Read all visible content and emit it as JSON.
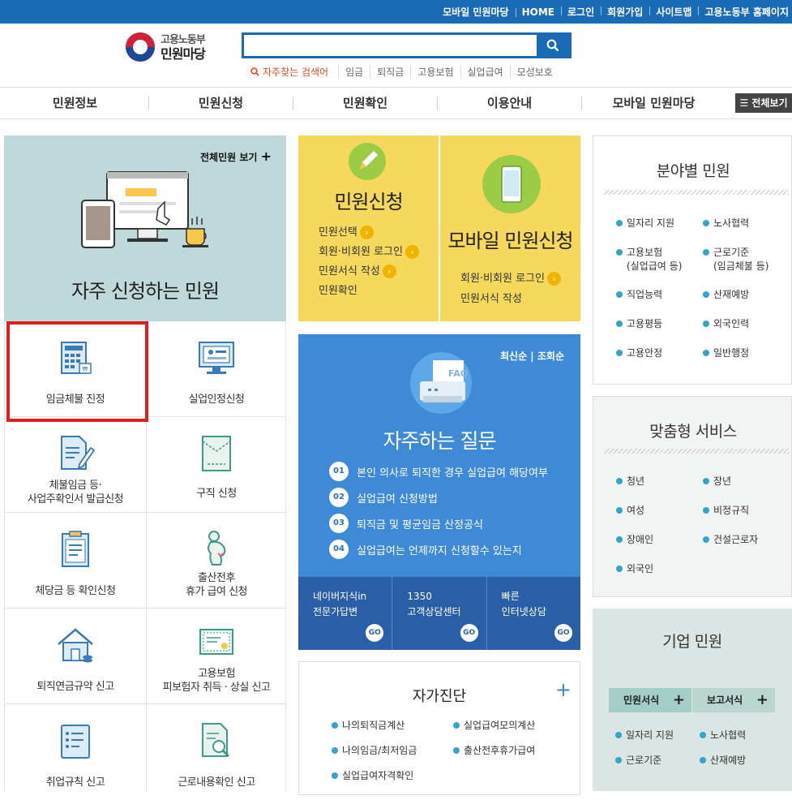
{
  "topbar": {
    "links": [
      "모바일 민원마당",
      "HOME",
      "로그인",
      "회원가입",
      "사이트맵",
      "고용노동부 홈페이지"
    ]
  },
  "logo": {
    "line1": "고용노동부",
    "line2": "민원마당"
  },
  "search": {
    "value": "",
    "placeholder": ""
  },
  "keywords": {
    "label": "자주찾는 검색어",
    "items": [
      "임금",
      "퇴직금",
      "고용보험",
      "실업급여",
      "모성보호"
    ]
  },
  "gnb": {
    "items": [
      "민원정보",
      "민원신청",
      "민원확인",
      "이용안내",
      "모바일 민원마당"
    ],
    "all": "전체보기"
  },
  "frequent": {
    "more": "전체민원 보기",
    "title": "자주 신청하는 민원",
    "cells": [
      {
        "label": [
          "임금체불 진정"
        ],
        "icon": "calculator-icon"
      },
      {
        "label": [
          "실업인정신청"
        ],
        "icon": "monitor-icon"
      },
      {
        "label": [
          "체불임금 등·",
          "사업주확인서 발급신청"
        ],
        "icon": "document-pen-icon"
      },
      {
        "label": [
          "구직 신청"
        ],
        "icon": "envelope-icon"
      },
      {
        "label": [
          "체당금 등 확인신청"
        ],
        "icon": "clipboard-icon"
      },
      {
        "label": [
          "출산전후",
          "휴가 급여 신청"
        ],
        "icon": "pregnant-icon"
      },
      {
        "label": [
          "퇴직연금규약 신고"
        ],
        "icon": "house-icon"
      },
      {
        "label": [
          "고용보험",
          "피보험자 취득 · 상실 신고"
        ],
        "icon": "certificate-icon"
      },
      {
        "label": [
          "취업규칙 신고"
        ],
        "icon": "rules-icon"
      },
      {
        "label": [
          "근로내용확인 신고"
        ],
        "icon": "magnifier-doc-icon"
      }
    ]
  },
  "apply": {
    "title": "민원신청",
    "links": [
      "민원선택",
      "회원·비회원 로그인",
      "민원서식 작성",
      "민원확인"
    ]
  },
  "mobile": {
    "title": "모바일 민원신청",
    "links": [
      "회원·비회원 로그인",
      "민원서식 작성"
    ]
  },
  "faq": {
    "sort": [
      "최신순",
      "조회순"
    ],
    "badge": "FAQ",
    "title": "자주하는 질문",
    "questions": [
      {
        "num": "01",
        "text": "본인 의사로 퇴직한 경우 실업급여 해당여부"
      },
      {
        "num": "02",
        "text": "실업급여 신청방법"
      },
      {
        "num": "03",
        "text": "퇴직금 및 평균임금 산정공식"
      },
      {
        "num": "04",
        "text": "실업급여는 언제까지 신청할수 있는지"
      }
    ],
    "bottom": [
      {
        "l1": "네이버지식in",
        "l2": "전문가답변",
        "go": "GO"
      },
      {
        "l1": "1350",
        "l2": "고객상담센터",
        "go": "GO"
      },
      {
        "l1": "빠른",
        "l2": "인터넷상담",
        "go": "GO"
      }
    ]
  },
  "selfcheck": {
    "title": "자가진단",
    "plus": "+",
    "items": [
      "나의퇴직금계산",
      "실업급여모의계산",
      "나의임금/최저임금",
      "출산전후휴가급여",
      "실업급여자격확인"
    ]
  },
  "field": {
    "title": "분야별 민원",
    "items": [
      [
        "일자리 지원"
      ],
      [
        "노사협력"
      ],
      [
        "고용보험",
        "(실업급여 등)"
      ],
      [
        "근로기준",
        "(임금체불 등)"
      ],
      [
        "직업능력"
      ],
      [
        "산재예방"
      ],
      [
        "고용평등"
      ],
      [
        "외국인력"
      ],
      [
        "고용안정"
      ],
      [
        "일반행정"
      ]
    ]
  },
  "custom": {
    "title": "맞춤형 서비스",
    "items": [
      "청년",
      "장년",
      "여성",
      "비정규직",
      "장애인",
      "건설근로자",
      "외국인"
    ]
  },
  "corp": {
    "title": "기업 민원",
    "tabs": [
      "민원서식",
      "보고서식"
    ],
    "plus": "+",
    "items": [
      "일자리 지원",
      "노사협력",
      "근로기준",
      "산재예방"
    ]
  },
  "colors": {
    "brand": "#1a6bb6",
    "yellow": "#f5d85c",
    "faq": "#3f8ad7",
    "highlight": "#e02020"
  }
}
